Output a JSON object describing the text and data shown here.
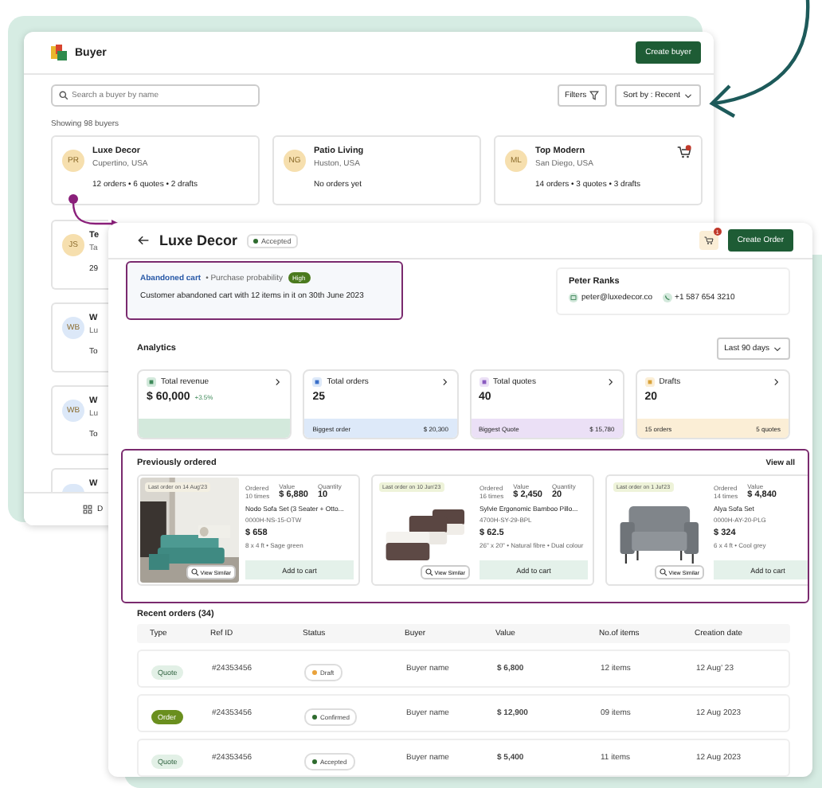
{
  "buyer_list": {
    "title": "Buyer",
    "create_button": "Create buyer",
    "search": {
      "placeholder": "Search a buyer by name"
    },
    "filters_button": "Filters",
    "sort_button": "Sort by : Recent",
    "count": "Showing 98 buyers",
    "buyers": [
      {
        "initials": "PR",
        "name": "Luxe Decor",
        "location": "Cupertino, USA",
        "summary": "12 orders • 6 quotes • 2 drafts",
        "color": "#f6dfae",
        "cart_alert": false
      },
      {
        "initials": "NG",
        "name": "Patio Living",
        "location": "Huston, USA",
        "summary": "No orders yet",
        "color": "#f6dfae",
        "cart_alert": false
      },
      {
        "initials": "ML",
        "name": "Top Modern",
        "location": "San Diego, USA",
        "summary": "14 orders • 3 quotes • 3 drafts",
        "color": "#f6dfae",
        "cart_alert": true
      },
      {
        "initials": "JS",
        "name": "Te",
        "location": "Ta",
        "summary": "29",
        "color": "#f6dfae"
      },
      {
        "initials": "WB",
        "name": "W",
        "location": "Lu",
        "summary": "To",
        "color": "#dce8f8"
      },
      {
        "initials": "WB",
        "name": "W",
        "location": "Lu",
        "summary": "To",
        "color": "#dce8f8"
      },
      {
        "name": "W",
        "color": "#dce8f8"
      }
    ],
    "footer_item": "D"
  },
  "buyer_detail": {
    "title": "Luxe Decor",
    "status": "Accepted",
    "create_button": "Create Order",
    "cart_count": "1",
    "alert": {
      "link": "Abandoned cart",
      "label": "• Purchase probability",
      "badge": "High",
      "text": "Customer abandoned cart with 12 items in it on 30th June 2023"
    },
    "contact": {
      "name": "Peter Ranks",
      "email": "peter@luxedecor.co",
      "phone": "+1 587 654 3210"
    },
    "analytics": {
      "title": "Analytics",
      "range": "Last 90 days",
      "metrics": [
        {
          "label": "Total revenue",
          "value": "$ 60,000",
          "change": "+3.5%",
          "color": "#d3e9dc"
        },
        {
          "label": "Total orders",
          "value": "25",
          "footer_left": "Biggest order",
          "footer_right": "$ 20,300",
          "color": "#dde9f9"
        },
        {
          "label": "Total quotes",
          "value": "40",
          "footer_left": "Biggest Quote",
          "footer_right": "$ 15,780",
          "color": "#ebe0f6"
        },
        {
          "label": "Drafts",
          "value": "20",
          "footer_left": "15 orders",
          "footer_right": "5 quotes",
          "color": "#fbeed6"
        }
      ]
    },
    "previously_ordered": {
      "title": "Previously ordered",
      "view_all": "View all",
      "products": [
        {
          "tag": "Last order on 14 Aug'23",
          "ordered_label": "Ordered",
          "ordered": "10 times",
          "value_label": "Value",
          "value": "$ 6,880",
          "quantity_label": "Quantity",
          "quantity": "10",
          "name": "Nodo Sofa Set (3 Seater + Otto...",
          "sku": "0000H-NS-15-OTW",
          "price": "$ 658",
          "specs": "8 x 4 ft • Sage green",
          "similar": "View Similar",
          "add": "Add to cart"
        },
        {
          "tag": "Last order on 10 Jun'23",
          "ordered_label": "Ordered",
          "ordered": "16 times",
          "value_label": "Value",
          "value": "$ 2,450",
          "quantity_label": "Quantity",
          "quantity": "20",
          "name": "Sylvie Ergonomic Bamboo Pillo...",
          "sku": "4700H-SY-29-BPL",
          "price": "$ 62.5",
          "specs": "26\" x 20\" • Natural fibre • Dual colour",
          "similar": "View Similar",
          "add": "Add to cart"
        },
        {
          "tag": "Last order on 1 Jul'23",
          "ordered_label": "Ordered",
          "ordered": "14 times",
          "value_label": "Value",
          "value": "$ 4,840",
          "name": "Alya Sofa Set",
          "sku": "0000H-AY-20-PLG",
          "price": "$ 324",
          "specs": "6 x 4 ft • Cool grey",
          "similar": "View Similar",
          "add": "Add to cart"
        }
      ]
    },
    "recent_orders": {
      "title": "Recent orders (34)",
      "columns": [
        "Type",
        "Ref ID",
        "Status",
        "Buyer",
        "Value",
        "No.of items",
        "Creation date"
      ],
      "rows": [
        {
          "type": "Quote",
          "kind": "quote",
          "ref": "#24353456",
          "status": "Draft",
          "color": "#e9a23b",
          "buyer": "Buyer name",
          "value": "$ 6,800",
          "items": "12 items",
          "date": "12 Aug' 23"
        },
        {
          "type": "Order",
          "kind": "order",
          "ref": "#24353456",
          "status": "Confirmed",
          "color": "#2e6b2e",
          "buyer": "Buyer name",
          "value": "$ 12,900",
          "items": "09 items",
          "date": "12 Aug 2023"
        },
        {
          "type": "Quote",
          "kind": "quote",
          "ref": "#24353456",
          "status": "Accepted",
          "color": "#2e6b2e",
          "buyer": "Buyer name",
          "value": "$ 5,400",
          "items": "11 items",
          "date": "12 Aug 2023"
        }
      ]
    }
  }
}
